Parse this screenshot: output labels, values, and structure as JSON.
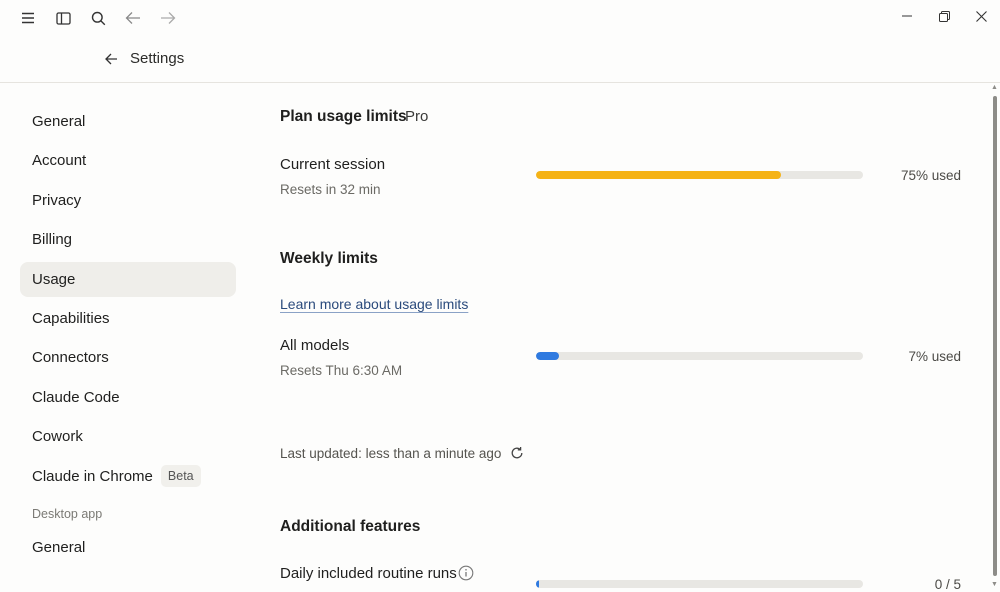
{
  "header": {
    "title": "Settings"
  },
  "sidebar": {
    "items": [
      {
        "label": "General"
      },
      {
        "label": "Account"
      },
      {
        "label": "Privacy"
      },
      {
        "label": "Billing"
      },
      {
        "label": "Usage"
      },
      {
        "label": "Capabilities"
      },
      {
        "label": "Connectors"
      },
      {
        "label": "Claude Code"
      },
      {
        "label": "Cowork"
      },
      {
        "label": "Claude in Chrome",
        "badge": "Beta"
      }
    ],
    "section_label": "Desktop app",
    "desktop_items": [
      {
        "label": "General"
      }
    ]
  },
  "main": {
    "plan": {
      "heading": "Plan usage limits",
      "tag": "Pro"
    },
    "current_session": {
      "title": "Current session",
      "sub": "Resets in 32 min",
      "pct_text": "75% used",
      "fraction": 0.75,
      "color": "#f5b316"
    },
    "weekly": {
      "heading": "Weekly limits",
      "link": "Learn more about usage limits"
    },
    "all_models": {
      "title": "All models",
      "sub": "Resets Thu 6:30 AM",
      "pct_text": "7% used",
      "fraction": 0.07,
      "color": "#2f7ae0"
    },
    "last_updated": "Last updated: less than a minute ago",
    "additional": {
      "heading": "Additional features"
    },
    "routine_runs": {
      "title": "Daily included routine runs",
      "count_text": "0 / 5",
      "fraction": 0.0,
      "color": "#2f7ae0"
    }
  }
}
